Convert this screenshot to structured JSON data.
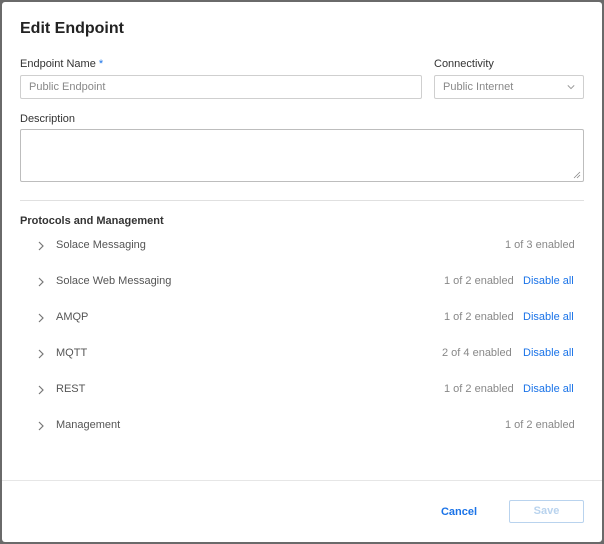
{
  "dialog": {
    "title": "Edit Endpoint"
  },
  "form": {
    "endpoint_name_label": "Endpoint Name",
    "required_marker": "*",
    "endpoint_name_value": "Public Endpoint",
    "connectivity_label": "Connectivity",
    "connectivity_value": "Public Internet",
    "description_label": "Description",
    "description_value": ""
  },
  "protocols": {
    "section_title": "Protocols and Management",
    "items": [
      {
        "name": "Solace Messaging",
        "count": "1 of 3 enabled",
        "action": ""
      },
      {
        "name": "Solace Web Messaging",
        "count": "1 of 2 enabled",
        "action": "Disable all"
      },
      {
        "name": "AMQP",
        "count": "1 of 2 enabled",
        "action": "Disable all"
      },
      {
        "name": "MQTT",
        "count": "2 of 4 enabled",
        "action": "Disable all"
      },
      {
        "name": "REST",
        "count": "1 of 2 enabled",
        "action": "Disable all"
      },
      {
        "name": "Management",
        "count": "1 of 2 enabled",
        "action": ""
      }
    ]
  },
  "footer": {
    "cancel_label": "Cancel",
    "save_label": "Save"
  },
  "colors": {
    "accent": "#1a73e8",
    "disabled_button": "#b9d3ee"
  }
}
